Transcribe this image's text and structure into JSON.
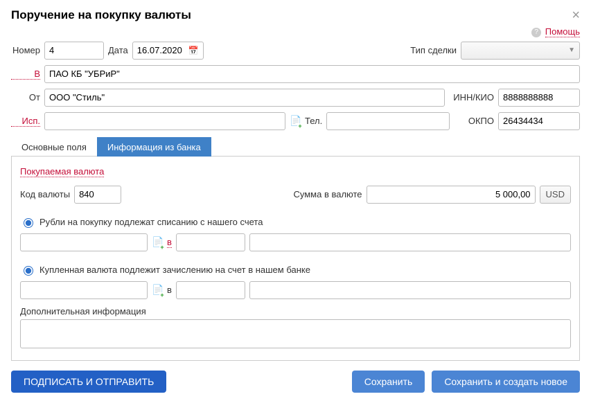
{
  "title": "Поручение на покупку валюты",
  "help": "Помощь",
  "labels": {
    "number": "Номер",
    "date": "Дата",
    "deal_type": "Тип сделки",
    "to": "В",
    "from": "От",
    "inn": "ИНН/КИО",
    "exec": "Исп.",
    "tel": "Тел.",
    "okpo": "ОКПО",
    "v1": "в",
    "v2": "в",
    "addl": "Дополнительная информация"
  },
  "tabs": {
    "main": "Основные поля",
    "bank": "Информация из банка"
  },
  "purchase": {
    "title": "Покупаемая валюта",
    "code_label": "Код валюты",
    "amount_label": "Сумма в валюте"
  },
  "radios": {
    "debit": "Рубли на покупку подлежат списанию с нашего счета",
    "credit": "Купленная валюта подлежит зачислению на счет в нашем банке"
  },
  "values": {
    "number": "4",
    "date": "16.07.2020",
    "deal_type": "",
    "to": "ПАО КБ \"УБРиР\"",
    "from": "ООО \"Стиль\"",
    "inn": "8888888888",
    "exec": "",
    "tel": "",
    "okpo": "26434434",
    "currency_code": "840",
    "amount": "5 000,00",
    "currency": "USD",
    "debit1": "",
    "debit2": "",
    "debit3": "",
    "credit1": "",
    "credit2": "",
    "credit3": "",
    "addl": ""
  },
  "buttons": {
    "sign": "Подписать и отправить",
    "save": "Сохранить",
    "save_new": "Сохранить и создать новое"
  }
}
